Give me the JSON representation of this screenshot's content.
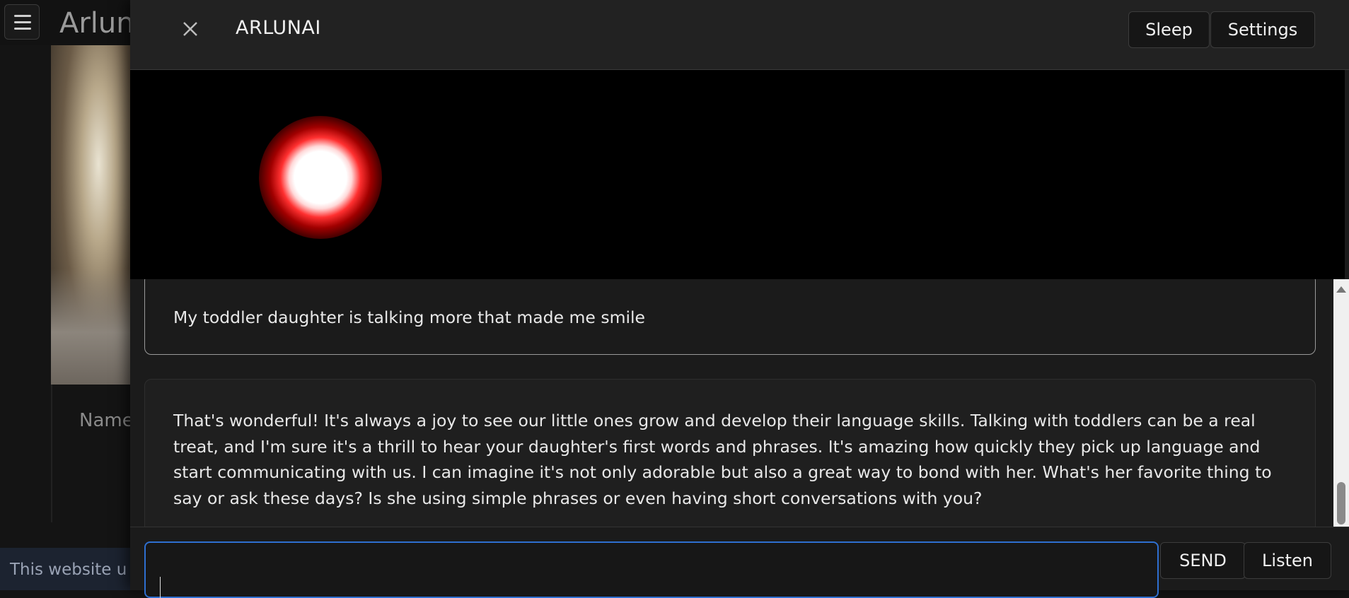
{
  "background": {
    "title": "Arlun",
    "name_label": "Name",
    "cookie_text": "This website u"
  },
  "modal": {
    "title": "ARLUNAI",
    "buttons": {
      "sleep": "Sleep",
      "settings": "Settings"
    }
  },
  "messages": [
    {
      "role": "user",
      "text": "My toddler daughter is talking more that made me smile"
    },
    {
      "role": "assistant",
      "text": "That's wonderful! It's always a joy to see our little ones grow and develop their language skills. Talking with toddlers can be a real treat, and I'm sure it's a thrill to hear your daughter's first words and phrases. It's amazing how quickly they pick up language and start communicating with us. I can imagine it's not only adorable but also a great way to bond with her. What's her favorite thing to say or ask these days? Is she using simple phrases or even having short conversations with you?"
    }
  ],
  "composer": {
    "value": "",
    "send_label": "SEND",
    "listen_label": "Listen"
  },
  "colors": {
    "input_focus": "#2e6fd0",
    "orb_glow": "#ff3030"
  }
}
